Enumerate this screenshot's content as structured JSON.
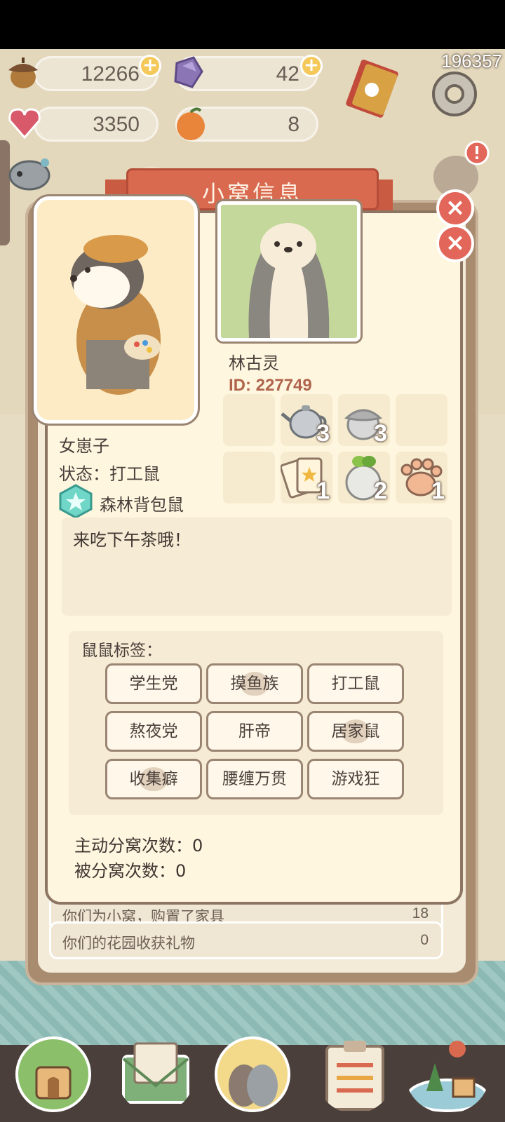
{
  "resources": {
    "acorn": "12266",
    "crystal": "42",
    "heart": "3350",
    "orange": "8",
    "coin_total": "196357"
  },
  "dialog": {
    "title": "小窝信息",
    "close_icon": "×"
  },
  "profile_right": {
    "name": "林古灵",
    "id": "ID: 227749"
  },
  "profile_left": {
    "name": "女崽子",
    "status": "状态：打工鼠",
    "rank": "森林背包鼠"
  },
  "items": [
    {
      "icon": "empty",
      "count": ""
    },
    {
      "icon": "teapot-icon",
      "count": "3"
    },
    {
      "icon": "acorn-icon",
      "count": "3"
    },
    {
      "icon": "empty",
      "count": ""
    },
    {
      "icon": "empty",
      "count": ""
    },
    {
      "icon": "cards-icon",
      "count": "1"
    },
    {
      "icon": "turnip-icon",
      "count": "2"
    },
    {
      "icon": "paw-icon",
      "count": "1"
    }
  ],
  "message": "来吃下午茶哦！",
  "tags": {
    "title": "鼠鼠标签：",
    "items": [
      "学生党",
      "摸鱼族",
      "打工鼠",
      "熬夜党",
      "肝帝",
      "居家鼠",
      "收集癖",
      "腰缠万贯",
      "游戏狂"
    ]
  },
  "split": {
    "active": "主动分窝次数：0",
    "passive": "被分窝次数：0"
  },
  "stats": [
    {
      "label": "你们为小窝，购置了家具",
      "value": "18"
    },
    {
      "label": "你们的花园收获礼物",
      "value": "0"
    }
  ],
  "colors": {
    "card_bg": "#fff6e0",
    "banner": "#d96a50",
    "close": "#e2665a",
    "id_text": "#b0644c"
  }
}
